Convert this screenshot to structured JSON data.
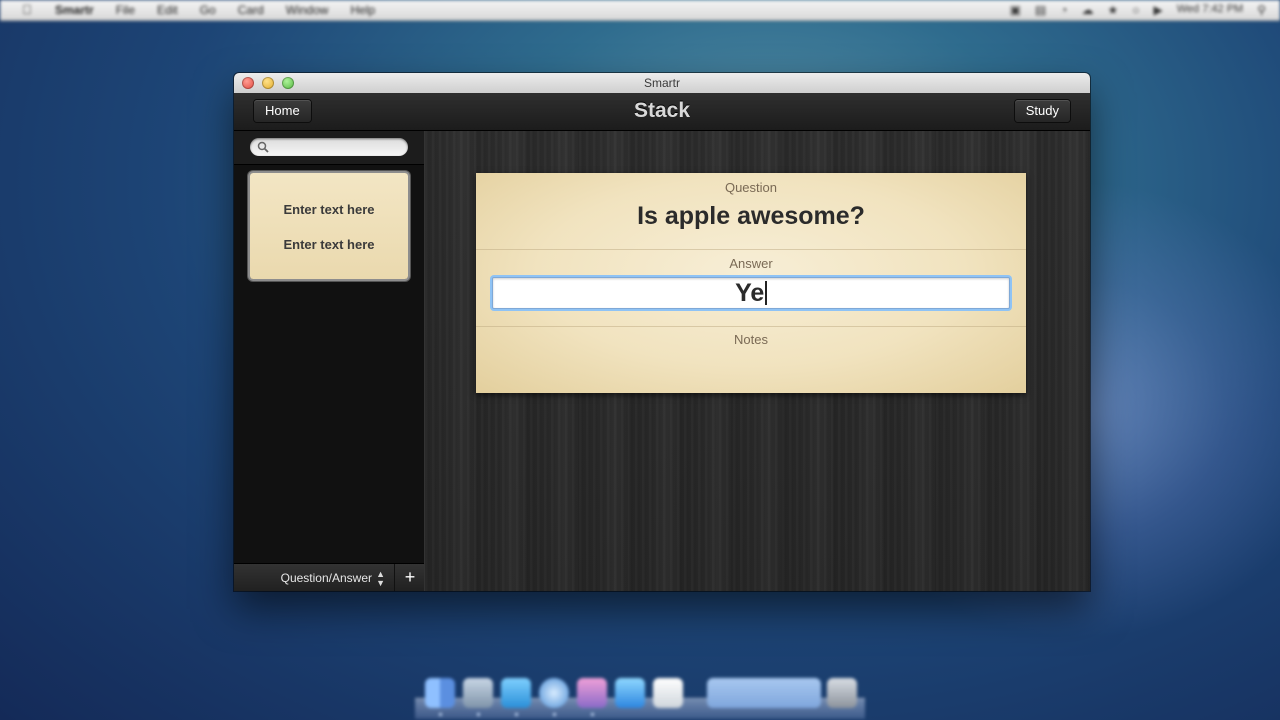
{
  "menubar": {
    "app_menu": "Smartr",
    "menus": [
      "File",
      "Edit",
      "Go",
      "Card",
      "Window",
      "Help"
    ],
    "clock": "Wed 7:42 PM"
  },
  "window": {
    "title": "Smartr"
  },
  "toolbar": {
    "home_label": "Home",
    "title": "Stack",
    "study_label": "Study"
  },
  "sidebar": {
    "search_placeholder": "",
    "cards": [
      {
        "front": "Enter text here",
        "back": "Enter text here"
      }
    ],
    "footer": {
      "type_select": "Question/Answer",
      "add_label": "+"
    }
  },
  "card": {
    "question_label": "Question",
    "question": "Is apple awesome?",
    "answer_label": "Answer",
    "answer_value": "Ye",
    "notes_label": "Notes"
  },
  "colors": {
    "card_paper": "#f1e3bf",
    "focus_ring": "#8fc3f5",
    "toolbar": "#262626"
  },
  "dock": {
    "icons": [
      "finder-icon",
      "preview-icon",
      "twitter-icon",
      "safari-icon",
      "photo-icon",
      "app-store-icon",
      "money-icon",
      "folder-stack-icon",
      "trash-icon"
    ]
  }
}
